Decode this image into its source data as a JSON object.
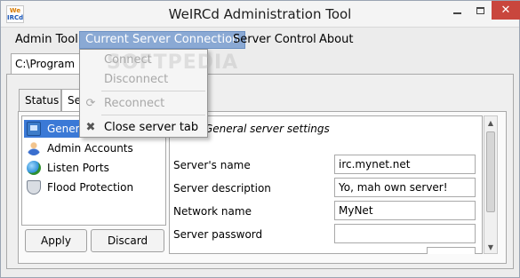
{
  "window": {
    "title": "WeIRCd Administration Tool",
    "icon_text_top": "We",
    "icon_text_bottom": "IRCd",
    "icons": {
      "minimize": "minimize-icon",
      "maximize": "maximize-icon",
      "close": "close-icon"
    },
    "colors": {
      "close_button": "#c9463d",
      "menu_active": "#8aa9d4",
      "tree_selected": "#3b79d6"
    }
  },
  "menubar": {
    "items": [
      "Admin Tool",
      "Current Server Connection",
      "Server Control",
      "About"
    ],
    "active_index": 1
  },
  "current_connection_menu": {
    "items": [
      {
        "label": "Connect",
        "enabled": false,
        "icon": "connect-icon"
      },
      {
        "label": "Disconnect",
        "enabled": false,
        "icon": "disconnect-icon"
      },
      {
        "label": "Reconnect",
        "enabled": false,
        "icon": "reconnect-icon"
      },
      {
        "label": "Close server tab",
        "enabled": true,
        "icon": "close-tab-icon"
      }
    ]
  },
  "watermark": "SOFTPEDIA",
  "server_tab": {
    "label": "C:\\Program Files"
  },
  "inner_tabs": [
    "Status",
    "Settings"
  ],
  "settings_tree": {
    "items": [
      {
        "label": "General",
        "icon": "monitor-icon",
        "selected": true
      },
      {
        "label": "Admin Accounts",
        "icon": "users-icon",
        "selected": false
      },
      {
        "label": "Listen Ports",
        "icon": "globe-icon",
        "selected": false
      },
      {
        "label": "Flood Protection",
        "icon": "shield-icon",
        "selected": false
      }
    ]
  },
  "buttons": {
    "apply": "Apply",
    "discard": "Discard"
  },
  "general_settings": {
    "section_title": "General server settings",
    "fields": [
      {
        "label": "Server's name",
        "value": "irc.mynet.net"
      },
      {
        "label": "Server description",
        "value": "Yo, mah own server!"
      },
      {
        "label": "Network name",
        "value": "MyNet"
      },
      {
        "label": "Server password",
        "value": ""
      }
    ]
  }
}
